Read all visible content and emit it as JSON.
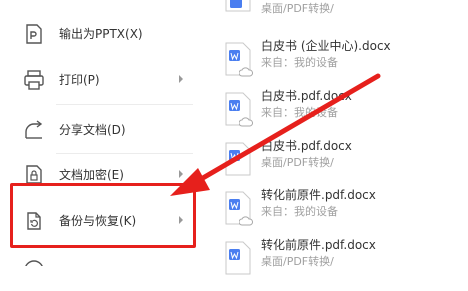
{
  "menu": {
    "items": [
      {
        "label": "输出为PPTX(X)",
        "icon": "ppt-export-icon",
        "has_arrow": false
      },
      {
        "label": "打印(P)",
        "icon": "printer-icon",
        "has_arrow": true
      },
      {
        "label": "分享文档(D)",
        "icon": "share-icon",
        "has_arrow": false
      },
      {
        "label": "文档加密(E)",
        "icon": "document-lock-icon",
        "has_arrow": true
      },
      {
        "label": "备份与恢复(K)",
        "icon": "backup-restore-icon",
        "has_arrow": true
      }
    ]
  },
  "files": [
    {
      "name": "",
      "sub": "桌面/PDF转换/",
      "cloud": false
    },
    {
      "name": "白皮书 (企业中心).docx",
      "sub": "来自：我的设备",
      "cloud": true
    },
    {
      "name": "白皮书.pdf.docx",
      "sub": "来自：我的设备",
      "cloud": true
    },
    {
      "name": "白皮书.pdf.docx",
      "sub": "桌面/PDF转换/",
      "cloud": false
    },
    {
      "name": "转化前原件.pdf.docx",
      "sub": "来自：我的设备",
      "cloud": true
    },
    {
      "name": "转化前原件.pdf.docx",
      "sub": "桌面/PDF转换/",
      "cloud": false
    }
  ],
  "colors": {
    "highlight": "#e6201c",
    "doc_blue": "#4a7ef0",
    "muted_text": "#a0a0a0"
  }
}
